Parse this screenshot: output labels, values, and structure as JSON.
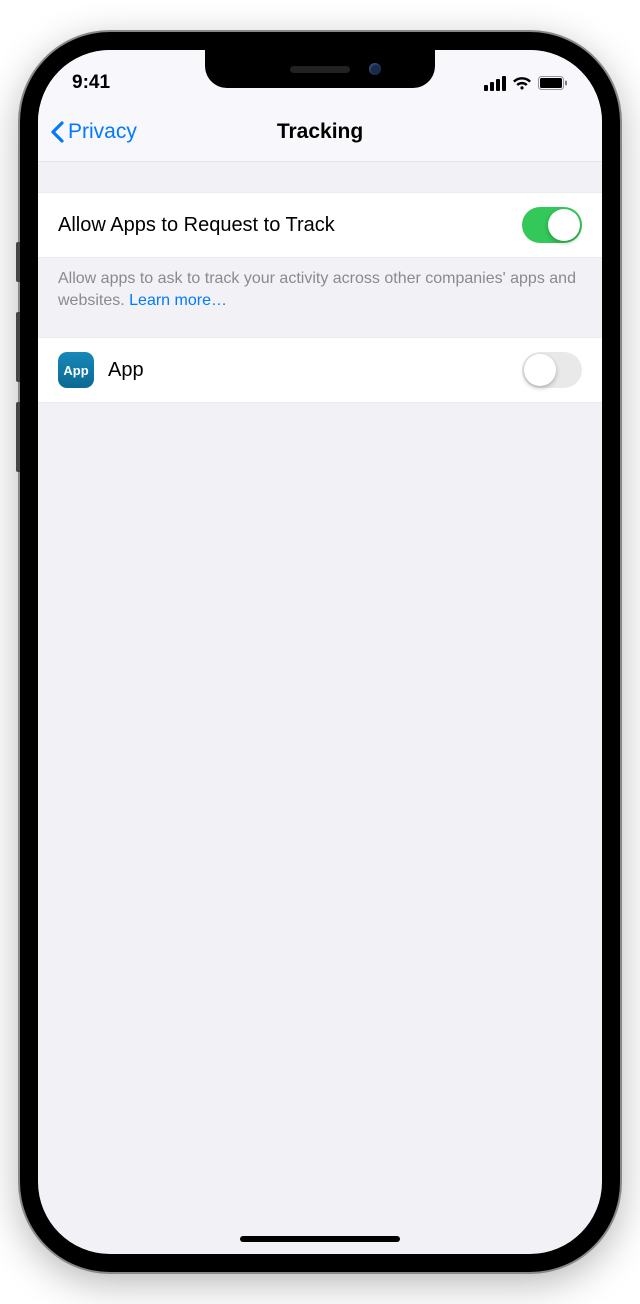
{
  "status": {
    "time": "9:41"
  },
  "nav": {
    "back_label": "Privacy",
    "title": "Tracking"
  },
  "tracking": {
    "allow_label": "Allow Apps to Request to Track",
    "allow_on": true,
    "footer": "Allow apps to ask to track your activity across other companies' apps and websites. ",
    "learn_more": "Learn more…"
  },
  "apps": [
    {
      "icon_text": "App",
      "name": "App",
      "on": false
    }
  ]
}
